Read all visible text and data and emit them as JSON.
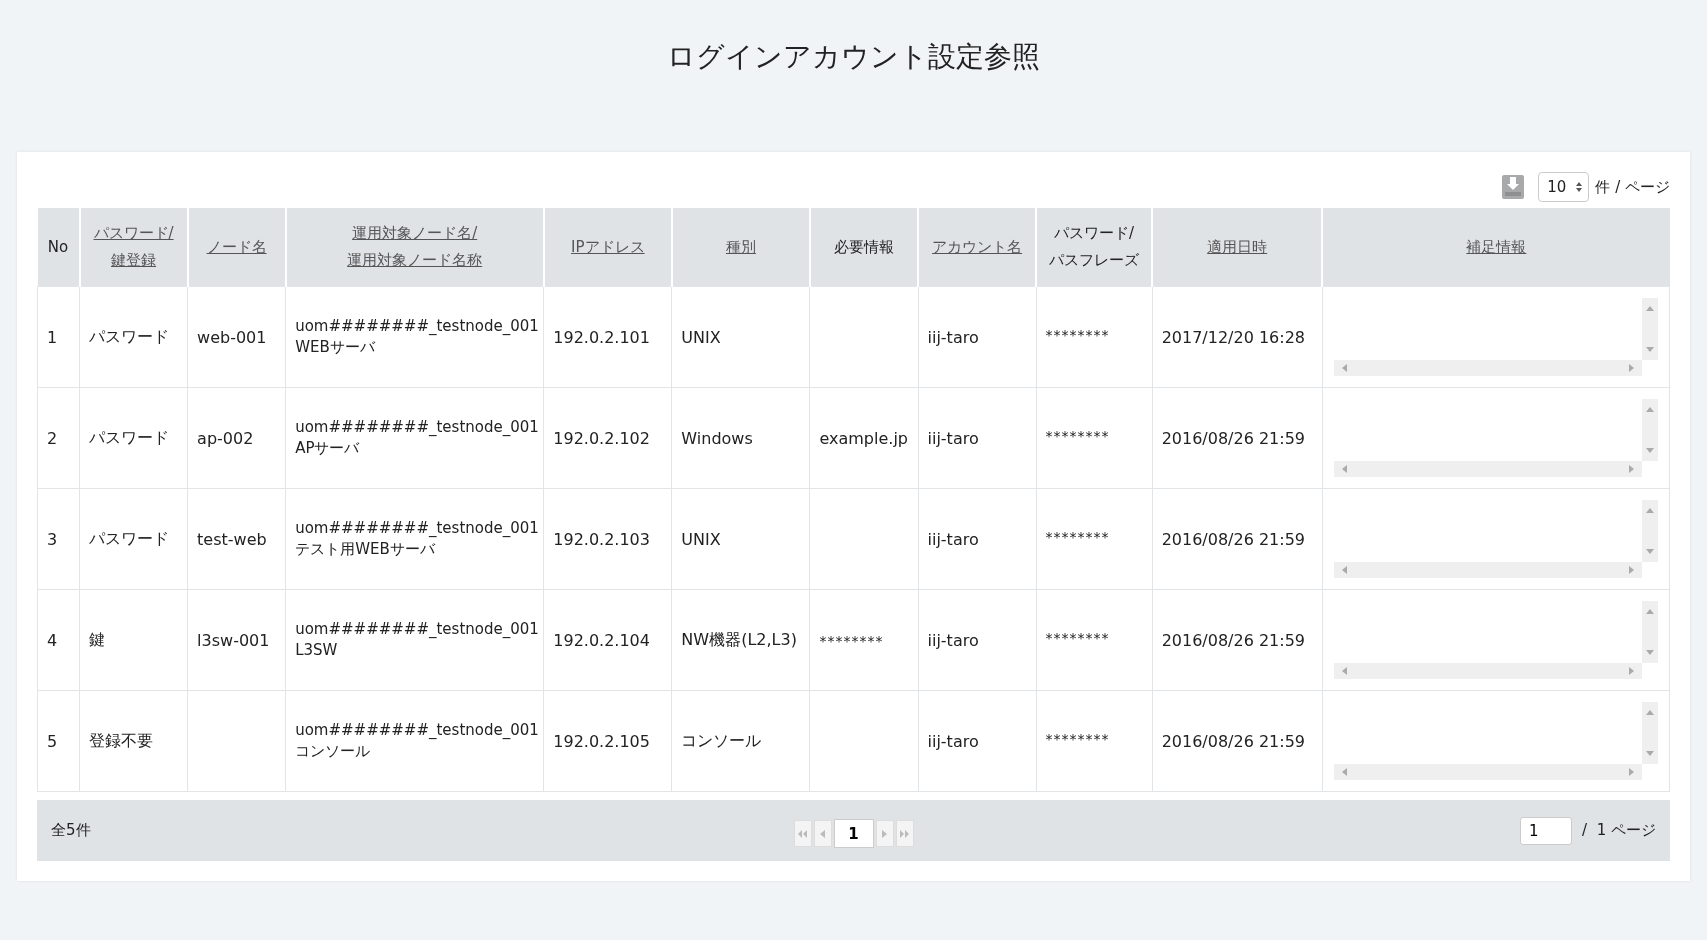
{
  "page": {
    "title": "ログインアカウント設定参照"
  },
  "toolbar": {
    "per_page": "10",
    "per_page_suffix": "件 / ページ"
  },
  "table": {
    "columns": [
      {
        "label": "No",
        "sortable": false
      },
      {
        "label": "パスワード/\n鍵登録",
        "sortable": true
      },
      {
        "label": "ノード名",
        "sortable": true
      },
      {
        "label": "運用対象ノード名/\n運用対象ノード名称",
        "sortable": true
      },
      {
        "label": "IPアドレス",
        "sortable": true
      },
      {
        "label": "種別",
        "sortable": true
      },
      {
        "label": "必要情報",
        "sortable": false
      },
      {
        "label": "アカウント名",
        "sortable": true
      },
      {
        "label": "パスワード/\nパスフレーズ",
        "sortable": false
      },
      {
        "label": "適用日時",
        "sortable": true
      },
      {
        "label": "補足情報",
        "sortable": true
      }
    ],
    "rows": [
      {
        "no": "1",
        "registration": "パスワード",
        "node": "web-001",
        "target": [
          "uom########_testnode_001",
          "WEBサーバ"
        ],
        "ip": "192.0.2.101",
        "type": "UNIX",
        "required": "",
        "account": "iij-taro",
        "password": "********",
        "applied": "2017/12/20 16:28"
      },
      {
        "no": "2",
        "registration": "パスワード",
        "node": "ap-002",
        "target": [
          "uom########_testnode_001",
          "APサーバ"
        ],
        "ip": "192.0.2.102",
        "type": "Windows",
        "required": "example.jp",
        "account": "iij-taro",
        "password": "********",
        "applied": "2016/08/26 21:59"
      },
      {
        "no": "3",
        "registration": "パスワード",
        "node": "test-web",
        "target": [
          "uom########_testnode_001",
          "テスト用WEBサーバ"
        ],
        "ip": "192.0.2.103",
        "type": "UNIX",
        "required": "",
        "account": "iij-taro",
        "password": "********",
        "applied": "2016/08/26 21:59"
      },
      {
        "no": "4",
        "registration": "鍵",
        "node": "l3sw-001",
        "target": [
          "uom########_testnode_001",
          "L3SW"
        ],
        "ip": "192.0.2.104",
        "type": "NW機器(L2,L3)",
        "required": "********",
        "account": "iij-taro",
        "password": "********",
        "applied": "2016/08/26 21:59"
      },
      {
        "no": "5",
        "registration": "登録不要",
        "node": "",
        "target": [
          "uom########_testnode_001",
          "コンソール"
        ],
        "ip": "192.0.2.105",
        "type": "コンソール",
        "required": "",
        "account": "iij-taro",
        "password": "********",
        "applied": "2016/08/26 21:59"
      }
    ]
  },
  "footer": {
    "total": "全5件",
    "pages": [
      {
        "label": "1",
        "selected": true
      }
    ],
    "first_disabled": true,
    "last_disabled": true,
    "page_input": "1",
    "page_suffix": "/  1 ページ"
  }
}
